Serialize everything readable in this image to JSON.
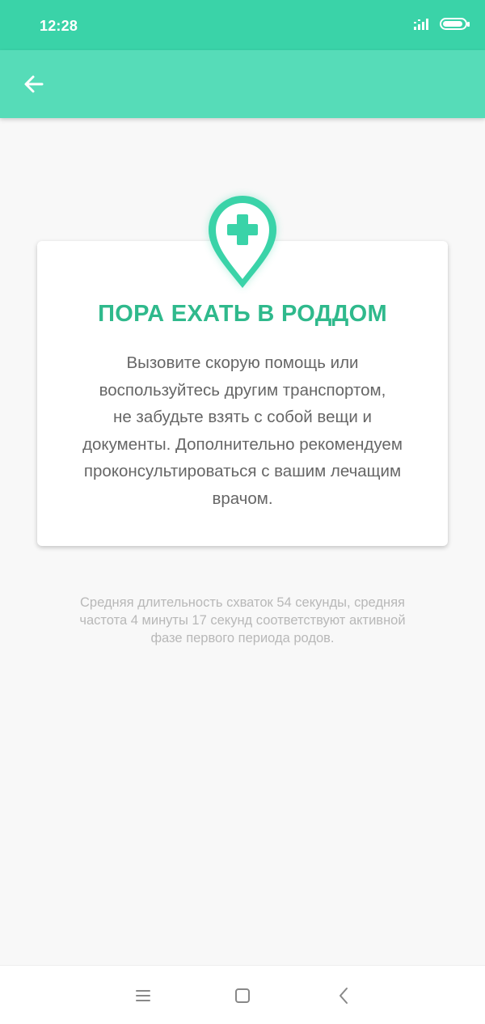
{
  "status_bar": {
    "time": "12:28",
    "icons": [
      "signal-icon",
      "battery-icon"
    ]
  },
  "app_bar": {
    "back_icon": "arrow-left-icon"
  },
  "card": {
    "icon": "hospital-location-pin-icon",
    "title": "ПОРА ЕХАТЬ В РОДДОМ",
    "body_lines": [
      "Вызовите скорую помощь или",
      "воспользуйтесь другим транспортом,",
      "не забудьте взять с собой вещи и",
      "документы. Дополнительно рекомендуем",
      "проконсультироваться с вашим лечащим",
      "врачом."
    ]
  },
  "footnote_lines": [
    "Средняя длительность схваток 54 секунды, средняя",
    "частота 4 минуты 17 секунд соответствуют активной",
    "фазе первого периода родов."
  ],
  "nav_bar": {
    "icons": [
      "menu-icon",
      "home-square-icon",
      "back-chevron-icon"
    ]
  },
  "colors": {
    "status_bar": "#3ad3a8",
    "app_bar": "#56dcb8",
    "accent": "#2fb98c",
    "pin": "#3ad3a8"
  }
}
